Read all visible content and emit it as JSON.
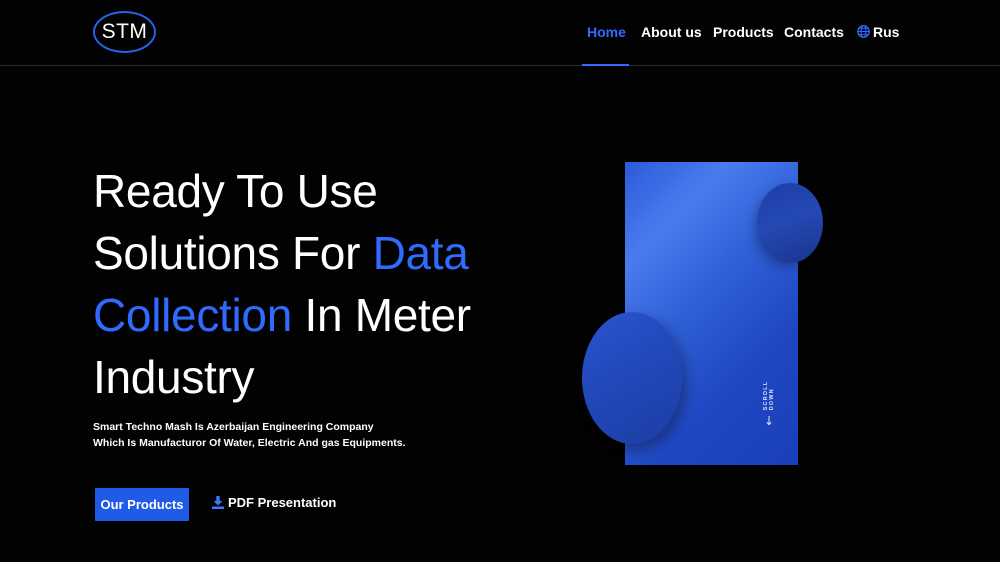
{
  "logo": {
    "text": "STM"
  },
  "nav": {
    "items": [
      {
        "label": "Home",
        "active": true
      },
      {
        "label": "About us",
        "active": false
      },
      {
        "label": "Products",
        "active": false
      },
      {
        "label": "Contacts",
        "active": false
      }
    ],
    "language": {
      "label": "Rus",
      "icon": "globe-icon"
    }
  },
  "hero": {
    "title_line1": "Ready To Use",
    "title_line2_a": "Solutions For ",
    "title_line2_accent": "Data",
    "title_line3_accent": "Collection",
    "title_line3_b": " In Meter",
    "title_line4": "Industry",
    "subtitle_line1": "Smart Techno Mash Is Azerbaijan Engineering Company",
    "subtitle_line2": "Which Is Manufacturor Of Water, Electric And gas Equipments."
  },
  "actions": {
    "primary_label": "Our Products",
    "secondary_label": "PDF Presentation",
    "secondary_icon": "download-icon"
  },
  "visual": {
    "scroll_label": "SCROLL DOWN",
    "scroll_icon": "arrow-down-icon"
  },
  "colors": {
    "accent": "#2f6bff",
    "button": "#1f5be6",
    "background": "#020203"
  }
}
